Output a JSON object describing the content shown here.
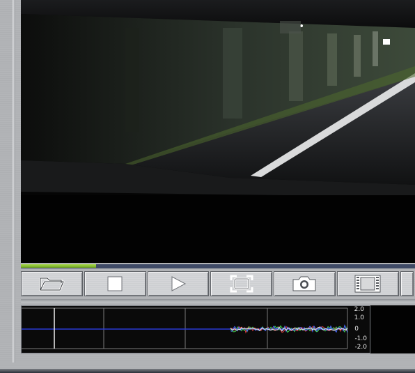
{
  "video": {
    "icon": "video-frame"
  },
  "playback": {
    "progress_fraction": 0.19
  },
  "toolbar": {
    "buttons": [
      {
        "icon": "folder-open-icon"
      },
      {
        "icon": "stop-icon"
      },
      {
        "icon": "play-icon"
      },
      {
        "icon": "fullscreen-icon"
      },
      {
        "icon": "camera-icon"
      },
      {
        "icon": "film-strip-icon"
      }
    ]
  },
  "graph": {
    "y_ticks": [
      "2.0",
      "1.0",
      "0",
      "-1.0",
      "-2.0"
    ],
    "colors": {
      "background": "#0a0a0a",
      "grid": "#7b7b7b",
      "baseline": "#2a3bd6",
      "marker": "#f0f0f0",
      "series": [
        "#e03a3a",
        "#3fd14b",
        "#4a6bff",
        "#e8e8e8"
      ]
    }
  },
  "colors": {
    "progress_fill": "#8cc63f",
    "progress_track": "#3f4a66",
    "frame": "#b0b2b5"
  }
}
